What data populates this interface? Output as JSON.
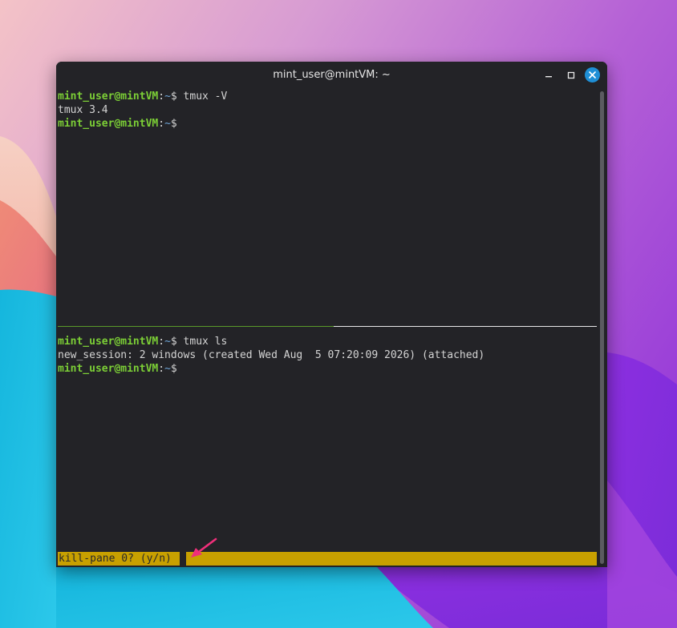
{
  "window": {
    "title": "mint_user@mintVM: ~",
    "controls": {
      "minimize": "–",
      "maximize": "□",
      "close": "×"
    }
  },
  "colors": {
    "terminal_bg": "#232327",
    "prompt_user": "#7ccf36",
    "prompt_path": "#6fa6d8",
    "status_bar": "#c8a000",
    "close_button": "#1f8fd6",
    "annotation_arrow": "#ef2f7a"
  },
  "top_pane": {
    "lines": [
      {
        "user": "mint_user@mintVM",
        "colon": ":",
        "path": "~",
        "suffix": "$ tmux -V"
      },
      {
        "output": "tmux 3.4"
      },
      {
        "user": "mint_user@mintVM",
        "colon": ":",
        "path": "~",
        "suffix": "$"
      }
    ]
  },
  "bottom_pane": {
    "lines": [
      {
        "user": "mint_user@mintVM",
        "colon": ":",
        "path": "~",
        "suffix": "$ tmux ls"
      },
      {
        "output": "new_session: 2 windows (created Wed Aug  5 07:20:09 2026) (attached)"
      },
      {
        "user": "mint_user@mintVM",
        "colon": ":",
        "path": "~",
        "suffix": "$"
      }
    ]
  },
  "status_bar": {
    "message": "kill-pane 0? (y/n)"
  },
  "icons": {
    "annotation": "arrow-pointer-icon",
    "minimize": "minimize-icon",
    "maximize": "maximize-icon",
    "close": "close-icon"
  }
}
